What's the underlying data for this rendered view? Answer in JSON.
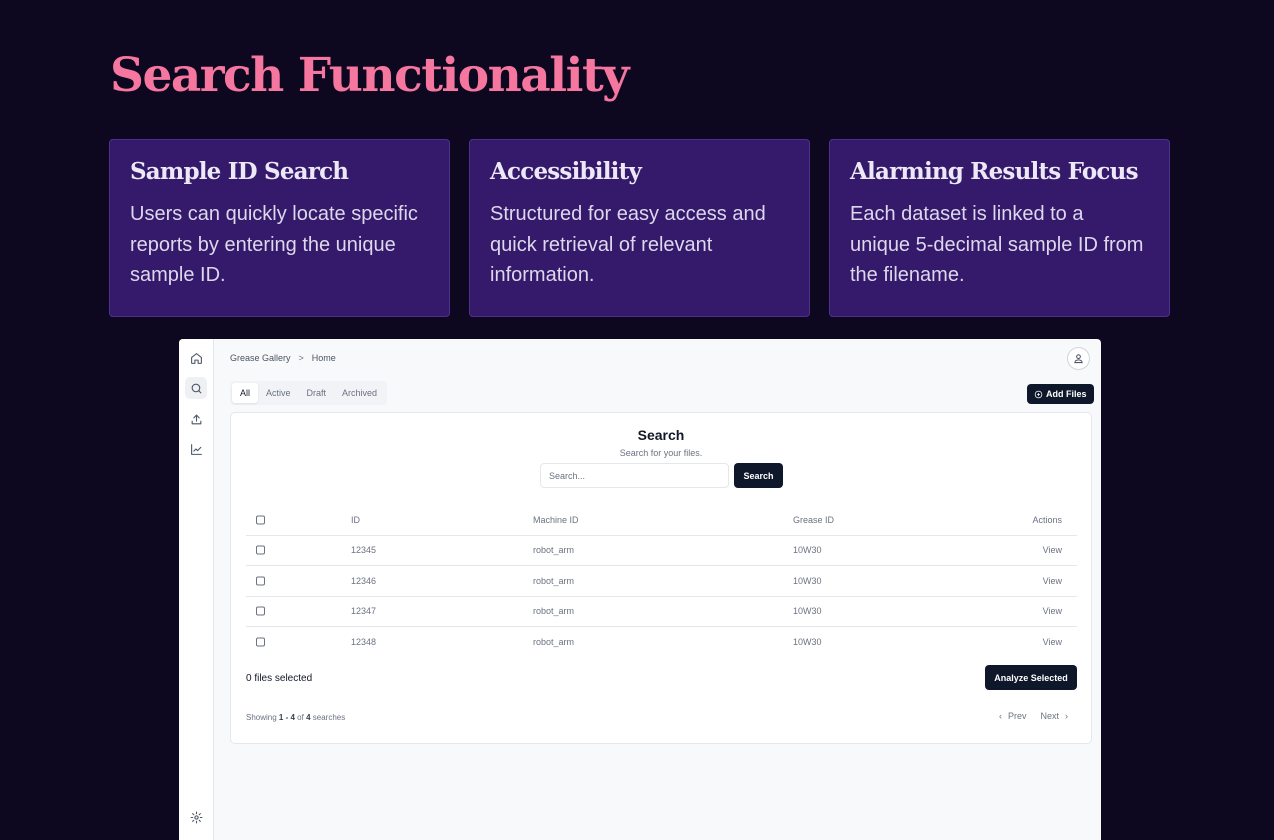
{
  "slide": {
    "title": "Search Functionality",
    "cards": [
      {
        "title": "Sample ID Search",
        "text": "Users can quickly locate specific reports by entering the unique sample ID."
      },
      {
        "title": "Accessibility",
        "text": "Structured for easy access and quick retrieval of relevant information."
      },
      {
        "title": "Alarming Results Focus",
        "text": "Each dataset is linked to a unique 5-decimal sample ID from the filename."
      }
    ]
  },
  "app": {
    "breadcrumb": {
      "root": "Grease Gallery",
      "sep": ">",
      "current": "Home"
    },
    "tabs": [
      {
        "label": "All",
        "active": true
      },
      {
        "label": "Active"
      },
      {
        "label": "Draft"
      },
      {
        "label": "Archived"
      }
    ],
    "add_files_label": "Add Files",
    "search": {
      "title": "Search",
      "subtitle": "Search for your files.",
      "placeholder": "Search...",
      "button_label": "Search"
    },
    "table": {
      "headers": {
        "id": "ID",
        "machine": "Machine ID",
        "grease": "Grease ID",
        "actions": "Actions"
      },
      "rows": [
        {
          "id": "12345",
          "machine": "robot_arm",
          "grease": "10W30",
          "action": "View"
        },
        {
          "id": "12346",
          "machine": "robot_arm",
          "grease": "10W30",
          "action": "View"
        },
        {
          "id": "12347",
          "machine": "robot_arm",
          "grease": "10W30",
          "action": "View"
        },
        {
          "id": "12348",
          "machine": "robot_arm",
          "grease": "10W30",
          "action": "View"
        }
      ]
    },
    "selected_text": "0 files selected",
    "analyze_label": "Analyze Selected",
    "showing": {
      "prefix": "Showing",
      "range": "1 - 4",
      "of": "of",
      "total": "4",
      "suffix": "searches"
    },
    "pager": {
      "prev": "Prev",
      "next": "Next"
    }
  }
}
